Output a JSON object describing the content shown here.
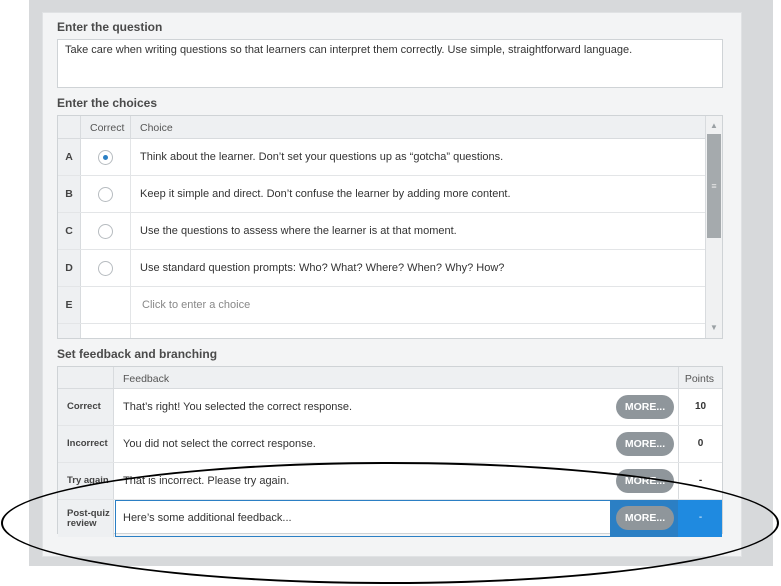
{
  "question": {
    "section_title": "Enter the question",
    "text": "Take care when writing questions so that learners can interpret them correctly. Use simple, straightforward language."
  },
  "choices": {
    "section_title": "Enter the choices",
    "col_correct": "Correct",
    "col_choice": "Choice",
    "rows": [
      {
        "letter": "A",
        "text": "Think about the learner. Don’t set your questions up as “gotcha” questions.",
        "selected": true
      },
      {
        "letter": "B",
        "text": "Keep it simple and direct. Don’t confuse the learner by adding more content.",
        "selected": false
      },
      {
        "letter": "C",
        "text": "Use the questions to assess where the learner is at that moment.",
        "selected": false
      },
      {
        "letter": "D",
        "text": "Use standard question prompts: Who? What? Where? When? Why? How?",
        "selected": false
      },
      {
        "letter": "E",
        "text": "Click to enter a choice",
        "selected": false
      }
    ],
    "scroll_up_icon": "▲",
    "scroll_down_icon": "▼",
    "scroll_grip": "≡"
  },
  "feedback": {
    "section_title": "Set feedback and branching",
    "col_feedback": "Feedback",
    "col_points": "Points",
    "more_label": "MORE...",
    "rows": [
      {
        "label": "Correct",
        "text": "That’s right!  You selected the correct response.",
        "points": "10"
      },
      {
        "label": "Incorrect",
        "text": "You did not select the correct response.",
        "points": "0"
      },
      {
        "label": "Try again",
        "text": "That is incorrect. Please try again.",
        "points": "-"
      },
      {
        "label": "Post-quiz review",
        "text": "Here’s some additional feedback...",
        "points": "-"
      }
    ]
  },
  "colors": {
    "accent": "#2b7fc4",
    "more_button": "#8f969b",
    "annotation_oval": "#000000"
  }
}
